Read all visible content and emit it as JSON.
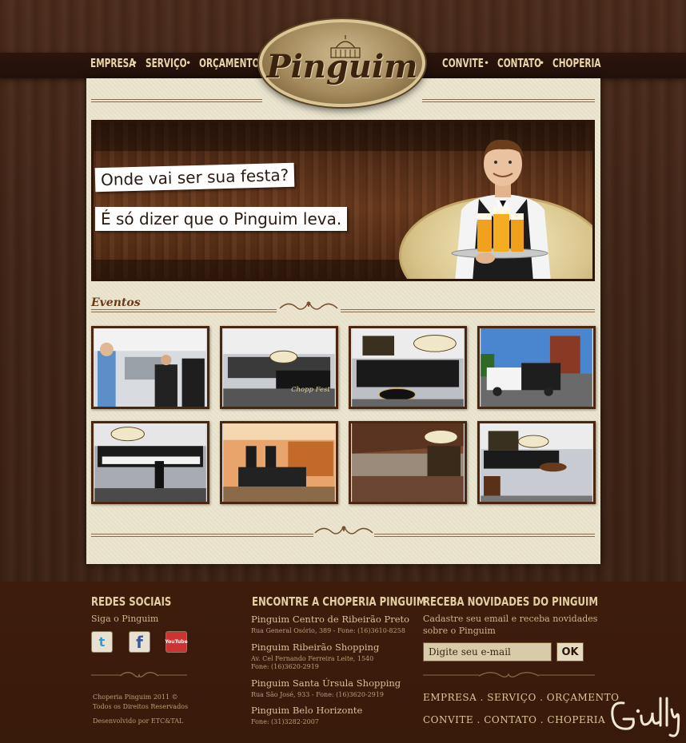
{
  "brand": {
    "logo_text": "Pinguim"
  },
  "nav": {
    "left": [
      "EMPRESA",
      "SERVIÇO",
      "ORÇAMENTO"
    ],
    "right": [
      "CONVITE",
      "CONTATO",
      "CHOPERIA"
    ],
    "separator": "•"
  },
  "banner": {
    "line1": "Onde vai ser sua festa?",
    "line2": "É só dizer que o Pinguim leva."
  },
  "events": {
    "title": "Eventos",
    "photos": [
      "event-photo-staff",
      "event-photo-chopp-fest-counter",
      "event-photo-pinguim-bar",
      "event-photo-truck",
      "event-photo-waiters-lineup",
      "event-photo-orange-room",
      "event-photo-outdoor-terrace",
      "event-photo-barrel-lounge"
    ]
  },
  "footer": {
    "social": {
      "title": "REDES SOCIAIS",
      "subtitle": "Siga o Pinguim",
      "icons": [
        "t",
        "f",
        "YouTube"
      ],
      "copyright1": "Choperia Pinguim 2011 ©",
      "copyright2": "Todos os Direitos Reservados",
      "developer": "Desenvolvido por ETC&TAL"
    },
    "locations": {
      "title": "ENCONTRE A CHOPERIA PINGUIM",
      "stores": [
        {
          "name": "Pinguim Centro de Ribeirão Preto",
          "line1": "Rua General Osório, 389 - Fone: (16)3610-8258",
          "line2": ""
        },
        {
          "name": "Pinguim Ribeirão Shopping",
          "line1": "Av. Cel Fernando Ferreira Leite, 1540",
          "line2": "Fone: (16)3620-2919"
        },
        {
          "name": "Pinguim Santa Úrsula Shopping",
          "line1": "Rua São José, 933 - Fone: (16)3620-2919",
          "line2": ""
        },
        {
          "name": "Pinguim Belo Horizonte",
          "line1": "Fone: (31)3282-2007",
          "line2": ""
        }
      ]
    },
    "newsletter": {
      "title": "RECEBA NOVIDADES DO PINGUIM",
      "text1": "Cadastre seu email e receba novidades",
      "text2": "sobre o Pinguim",
      "placeholder": "Digite seu e-mail",
      "button": "OK"
    },
    "nav_row1": [
      "EMPRESA",
      "SERVIÇO",
      "ORÇAMENTO"
    ],
    "nav_row2": [
      "CONVITE",
      "CONTATO",
      "CHOPERIA"
    ],
    "nav_sep": "."
  }
}
